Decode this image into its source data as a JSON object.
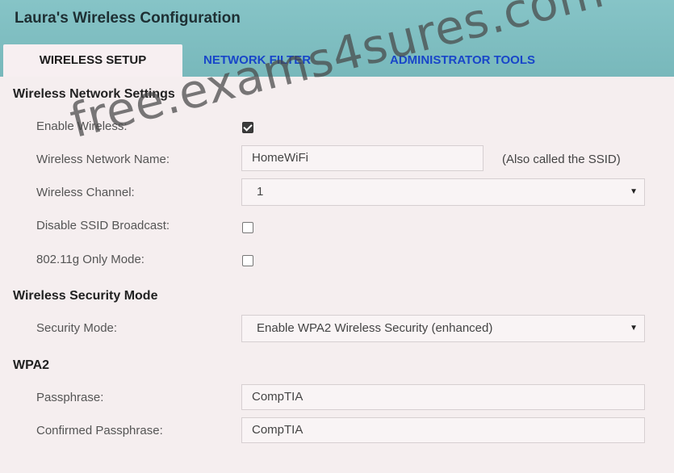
{
  "app": {
    "title": "Laura's Wireless Configuration"
  },
  "tabs": [
    {
      "label": "WIRELESS SETUP",
      "active": true
    },
    {
      "label": "NETWORK FILTER",
      "active": false
    },
    {
      "label": "ADMINISTRATOR TOOLS",
      "active": false
    }
  ],
  "wireless_settings": {
    "title": "Wireless Network Settings",
    "enable_wireless": {
      "label": "Enable Wireless:",
      "checked": true
    },
    "network_name": {
      "label": "Wireless Network Name:",
      "value": "HomeWiFi",
      "hint": "(Also called the SSID)"
    },
    "channel": {
      "label": "Wireless Channel:",
      "value": "1"
    },
    "disable_ssid_broadcast": {
      "label": "Disable SSID Broadcast:",
      "checked": false
    },
    "g_only_mode": {
      "label": "802.11g Only Mode:",
      "checked": false
    }
  },
  "security": {
    "title": "Wireless Security Mode",
    "mode": {
      "label": "Security Mode:",
      "value": "Enable WPA2 Wireless Security (enhanced)"
    }
  },
  "wpa2": {
    "title": "WPA2",
    "passphrase": {
      "label": "Passphrase:",
      "value": "CompTIA"
    },
    "confirm": {
      "label": "Confirmed Passphrase:",
      "value": "CompTIA"
    }
  },
  "watermark": "free.exams4sures.com",
  "colors": {
    "header": "#80bfc2",
    "tab_link": "#1846c9",
    "body": "#f5eeef"
  }
}
